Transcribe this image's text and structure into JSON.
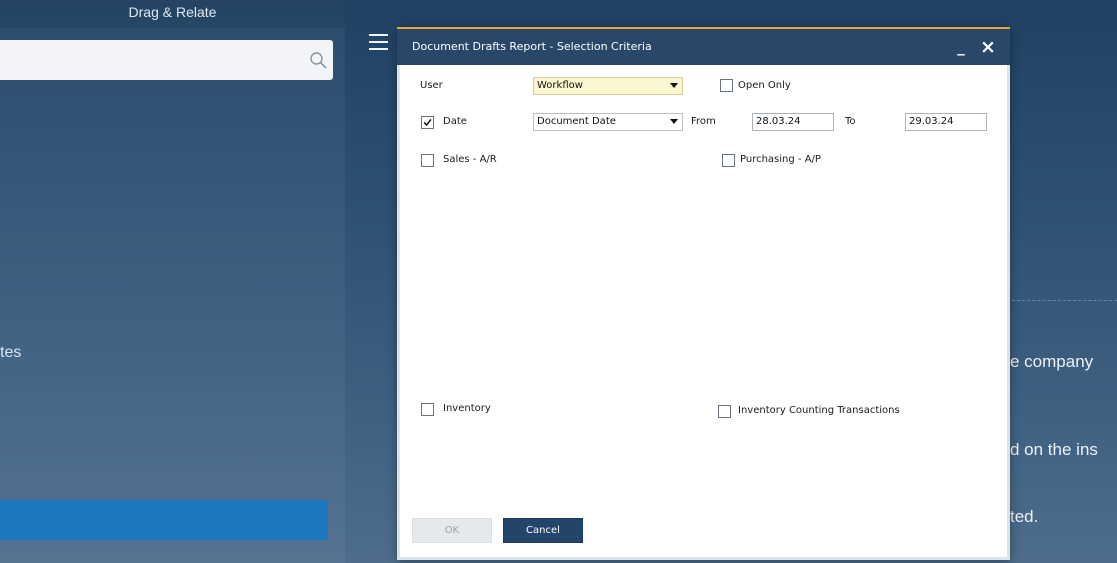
{
  "sidebar": {
    "header": "Drag & Relate",
    "partial_item_label": "tes"
  },
  "background_message": {
    "lines": [
      "e company",
      "d on the ins",
      "ted."
    ]
  },
  "dialog": {
    "title": "Document Drafts Report - Selection Criteria",
    "window_buttons": {
      "minimize": "_",
      "close": "×"
    },
    "user": {
      "label": "User",
      "selected": "Workflow",
      "focused": true
    },
    "open_only": {
      "label": "Open Only",
      "checked": false
    },
    "date": {
      "label": "Date",
      "checked": true,
      "type_selected": "Document Date",
      "from_label": "From",
      "from_value": "28.03.24",
      "to_label": "To",
      "to_value": "29.03.24"
    },
    "sales_ar": {
      "label": "Sales - A/R",
      "checked": false
    },
    "purchasing_ap": {
      "label": "Purchasing - A/P",
      "checked": false
    },
    "inventory": {
      "label": "Inventory",
      "checked": false
    },
    "inventory_counting": {
      "label": "Inventory Counting Transactions",
      "checked": false
    },
    "buttons": {
      "ok": "OK",
      "ok_disabled": true,
      "cancel": "Cancel"
    }
  },
  "icons": {
    "menu": "hamburger-menu-icon",
    "search": "search-icon",
    "dropdown": "dropdown-arrow-icon",
    "check": "checkmark-icon",
    "minimize": "minimize-icon",
    "close": "close-icon"
  },
  "colors": {
    "accent_orange": "#e9a43c",
    "title_bar": "#294869",
    "cancel_button": "#23456a",
    "sidebar_selected": "#1c78bf",
    "focused_field": "#fdf5cf"
  }
}
